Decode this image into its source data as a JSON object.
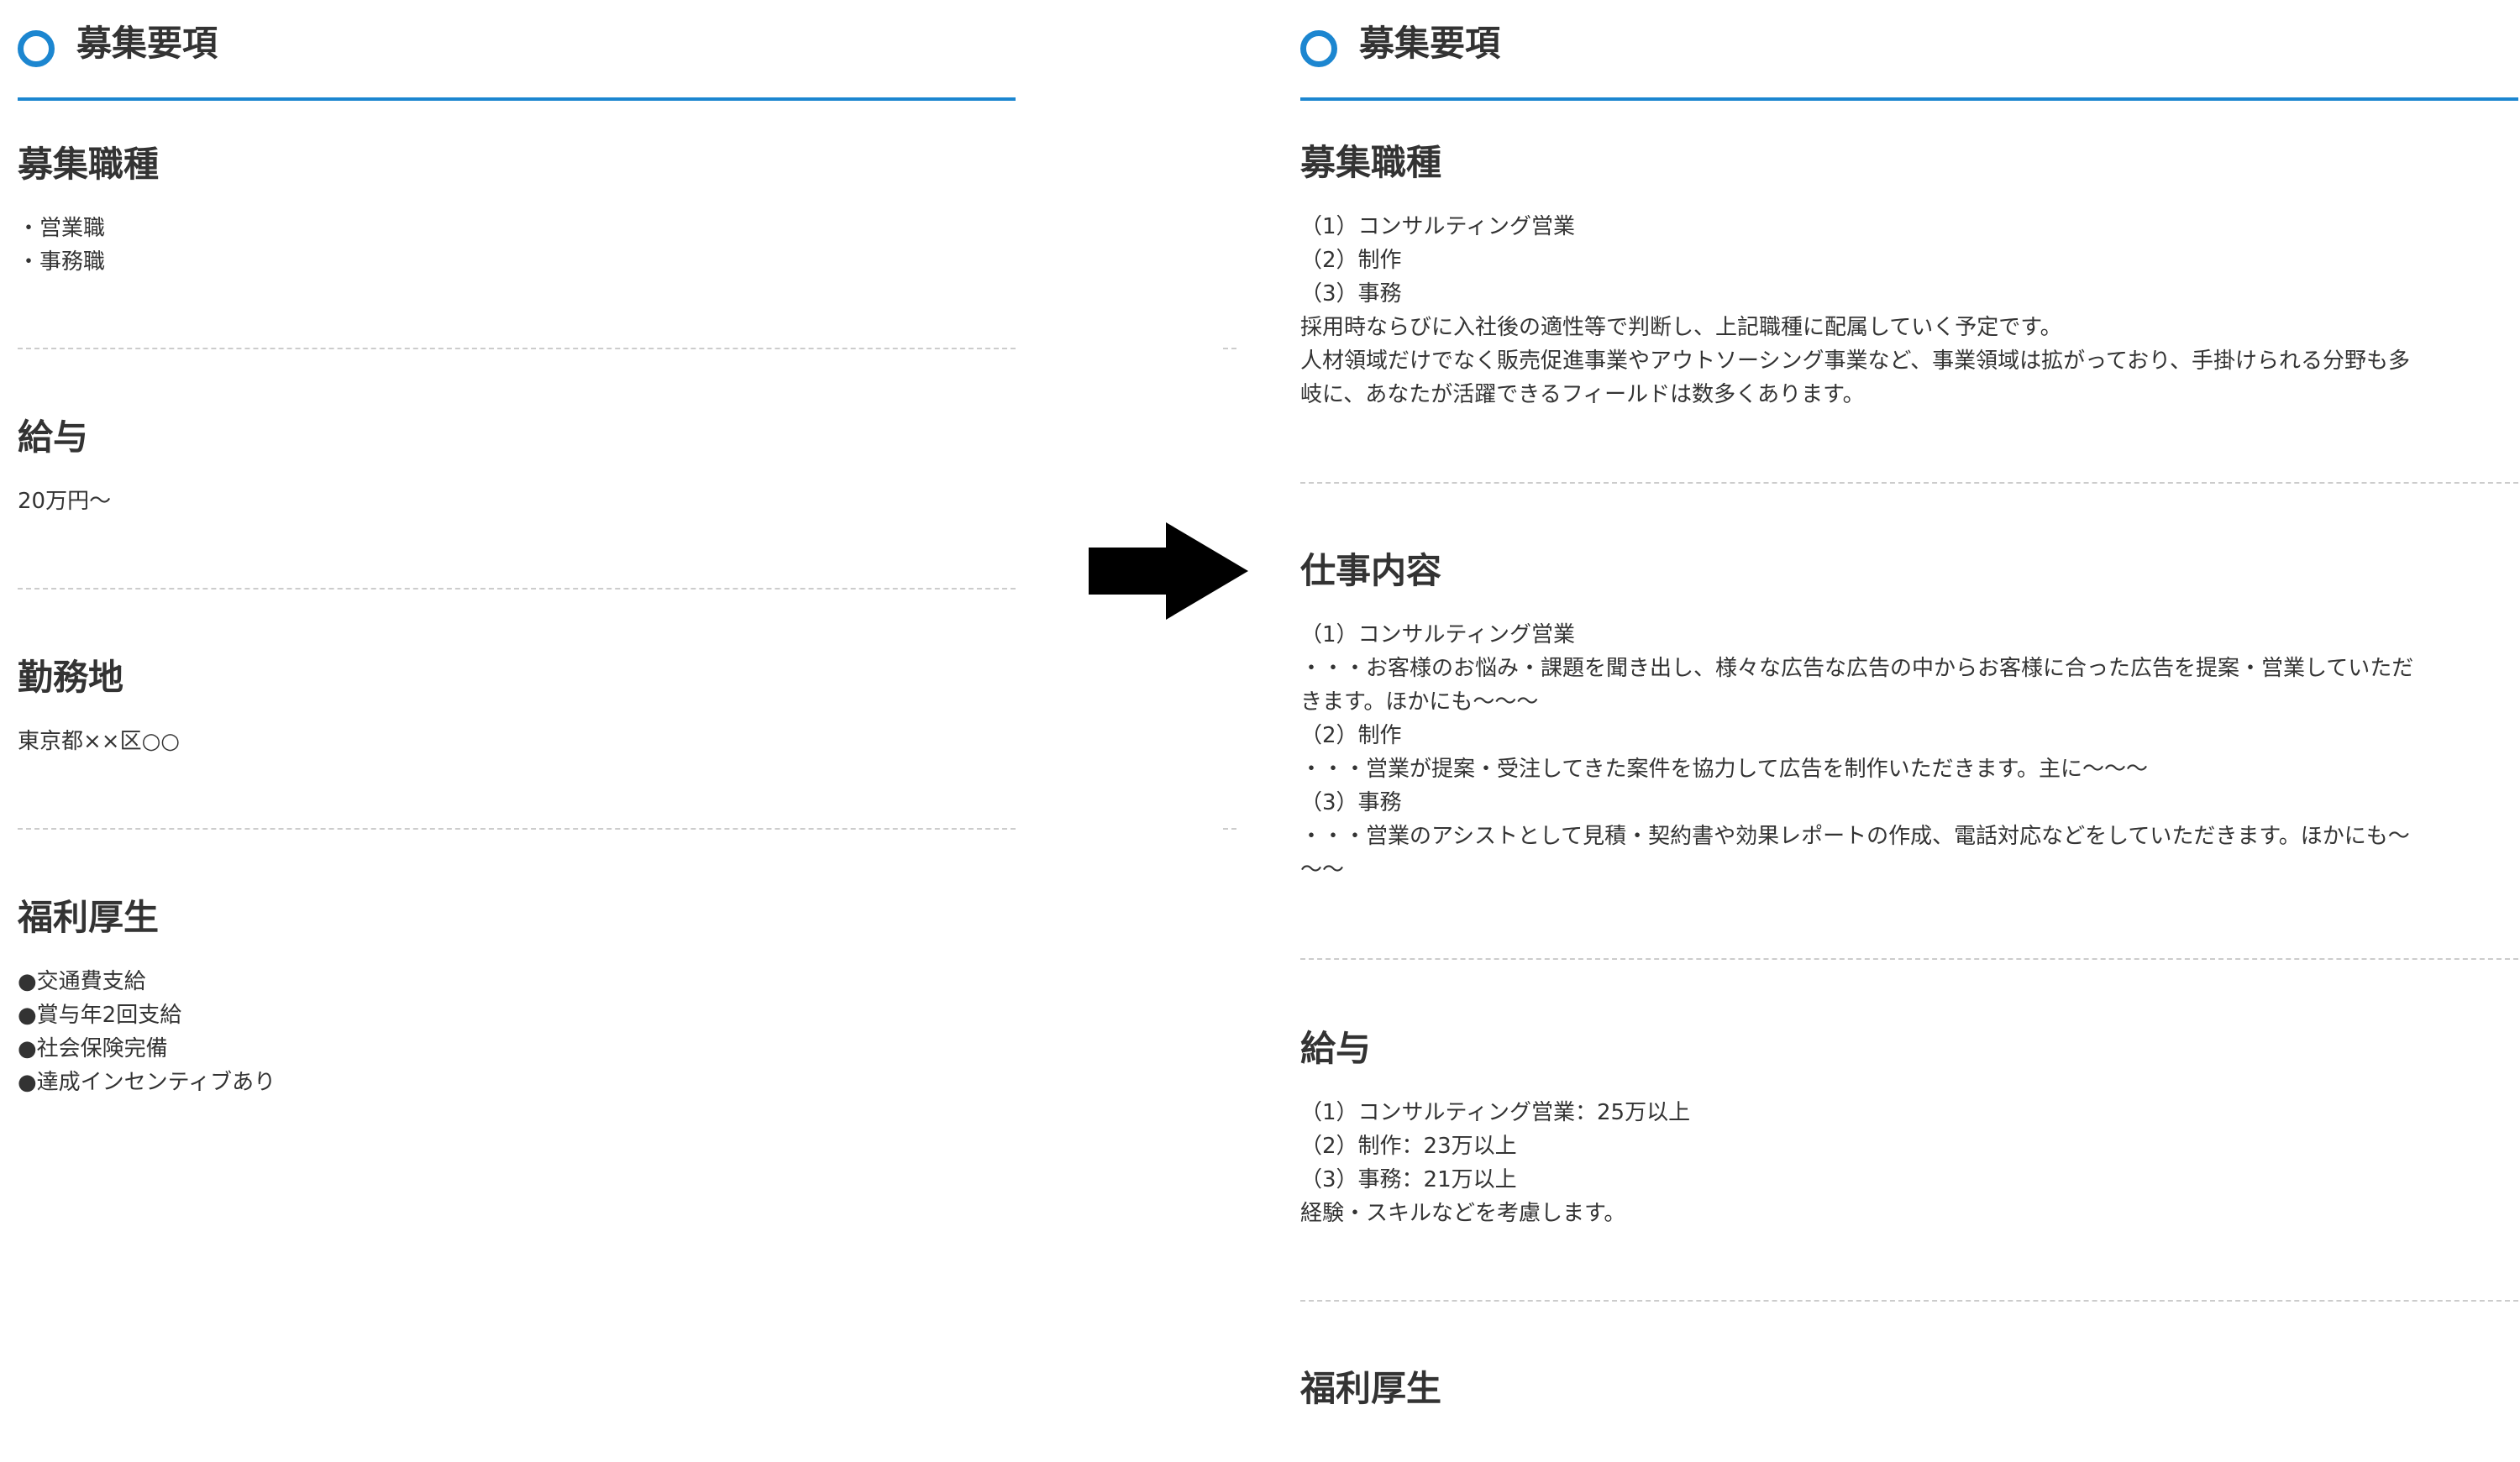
{
  "left_panel": {
    "title": "募集要項",
    "sections": [
      {
        "heading": "募集職種",
        "lines": [
          "・営業職",
          "・事務職"
        ]
      },
      {
        "heading": "給与",
        "lines": [
          "20万円～"
        ]
      },
      {
        "heading": "勤務地",
        "lines": [
          "東京都××区○○"
        ]
      },
      {
        "heading": "福利厚生",
        "lines": [
          "●交通費支給",
          "●賞与年2回支給",
          "●社会保険完備",
          "●達成インセンティブあり"
        ]
      }
    ]
  },
  "right_panel": {
    "title": "募集要項",
    "sections": [
      {
        "heading": "募集職種",
        "lines": [
          "（1）コンサルティング営業",
          "（2）制作",
          "（3）事務",
          "採用時ならびに入社後の適性等で判断し、上記職種に配属していく予定です。",
          "人材領域だけでなく販売促進事業やアウトソーシング事業など、事業領域は拡がっており、手掛けられる分野も多",
          "岐に、あなたが活躍できるフィールドは数多くあります。"
        ]
      },
      {
        "heading": "仕事内容",
        "lines": [
          "（1）コンサルティング営業",
          "・・・お客様のお悩み・課題を聞き出し、様々な広告な広告の中からお客様に合った広告を提案・営業していただ",
          "きます。ほかにも～～～",
          "（2）制作",
          "・・・営業が提案・受注してきた案件を協力して広告を制作いただきます。主に～～～",
          "（3）事務",
          "・・・営業のアシストとして見積・契約書や効果レポートの作成、電話対応などをしていただきます。ほかにも～",
          "～～"
        ]
      },
      {
        "heading": "給与",
        "lines": [
          "（1）コンサルティング営業：25万以上",
          "（2）制作：23万以上",
          "（3）事務：21万以上",
          "経験・スキルなどを考慮します。"
        ]
      },
      {
        "heading": "福利厚生",
        "lines": []
      }
    ]
  },
  "colors": {
    "accent": "#1c86d0",
    "text": "#333333",
    "divider": "#cccccc",
    "arrow": "#000000"
  },
  "icons": {
    "title_marker": "ring-icon",
    "transition": "right-arrow-icon"
  }
}
